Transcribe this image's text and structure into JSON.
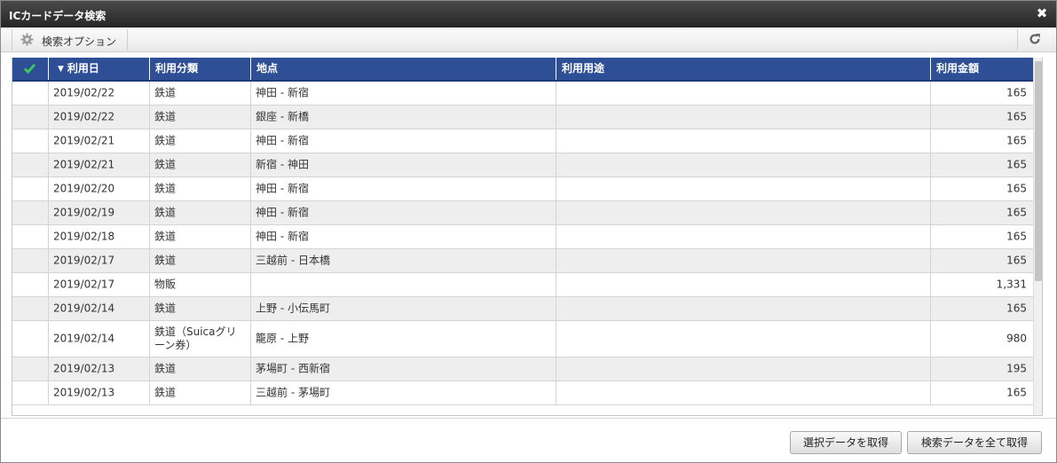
{
  "window": {
    "title": "ICカードデータ検索"
  },
  "toolbar": {
    "search_options_label": "検索オプション"
  },
  "table": {
    "headers": {
      "date": "利用日",
      "category": "利用分類",
      "place": "地点",
      "purpose": "利用用途",
      "amount": "利用金額"
    },
    "sort_indicator": "▼",
    "rows": [
      {
        "date": "2019/02/22",
        "category": "鉄道",
        "place": "神田 - 新宿",
        "purpose": "",
        "amount": "165"
      },
      {
        "date": "2019/02/22",
        "category": "鉄道",
        "place": "銀座 - 新橋",
        "purpose": "",
        "amount": "165"
      },
      {
        "date": "2019/02/21",
        "category": "鉄道",
        "place": "神田 - 新宿",
        "purpose": "",
        "amount": "165"
      },
      {
        "date": "2019/02/21",
        "category": "鉄道",
        "place": "新宿 - 神田",
        "purpose": "",
        "amount": "165"
      },
      {
        "date": "2019/02/20",
        "category": "鉄道",
        "place": "神田 - 新宿",
        "purpose": "",
        "amount": "165"
      },
      {
        "date": "2019/02/19",
        "category": "鉄道",
        "place": "神田 - 新宿",
        "purpose": "",
        "amount": "165"
      },
      {
        "date": "2019/02/18",
        "category": "鉄道",
        "place": "神田 - 新宿",
        "purpose": "",
        "amount": "165"
      },
      {
        "date": "2019/02/17",
        "category": "鉄道",
        "place": "三越前 - 日本橋",
        "purpose": "",
        "amount": "165"
      },
      {
        "date": "2019/02/17",
        "category": "物販",
        "place": "",
        "purpose": "",
        "amount": "1,331"
      },
      {
        "date": "2019/02/14",
        "category": "鉄道",
        "place": "上野 - 小伝馬町",
        "purpose": "",
        "amount": "165"
      },
      {
        "date": "2019/02/14",
        "category": "鉄道（Suicaグリーン券）",
        "place": "籠原 - 上野",
        "purpose": "",
        "amount": "980"
      },
      {
        "date": "2019/02/13",
        "category": "鉄道",
        "place": "茅場町 - 西新宿",
        "purpose": "",
        "amount": "195"
      },
      {
        "date": "2019/02/13",
        "category": "鉄道",
        "place": "三越前 - 茅場町",
        "purpose": "",
        "amount": "165"
      }
    ]
  },
  "footer": {
    "get_selected_label": "選択データを取得",
    "get_all_label": "検索データを全て取得"
  },
  "colors": {
    "header_bg": "#2e4f96",
    "titlebar_bg": "#262626",
    "check_green": "#3cc85a",
    "row_alt": "#eeeeee"
  },
  "icons": {
    "close": "close-icon",
    "options": "gear-icon",
    "refresh": "refresh-icon",
    "header_check": "checkmark-icon"
  }
}
